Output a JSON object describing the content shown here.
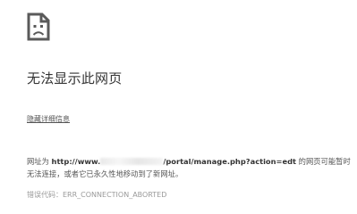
{
  "error": {
    "icon": "sad-document-icon",
    "title": "无法显示此网页",
    "details_link": "隐藏详细信息",
    "message": {
      "prefix": "网址为",
      "url_start": "http://www.",
      "url_end": "/portal/manage.php?action=edt",
      "suffix_line1": "的网页可能暂时",
      "line2": "无法连接，或者它已永久性地移动到了新网址。"
    },
    "code_label": "错误代码：",
    "code": "ERR_CONNECTION_ABORTED"
  }
}
